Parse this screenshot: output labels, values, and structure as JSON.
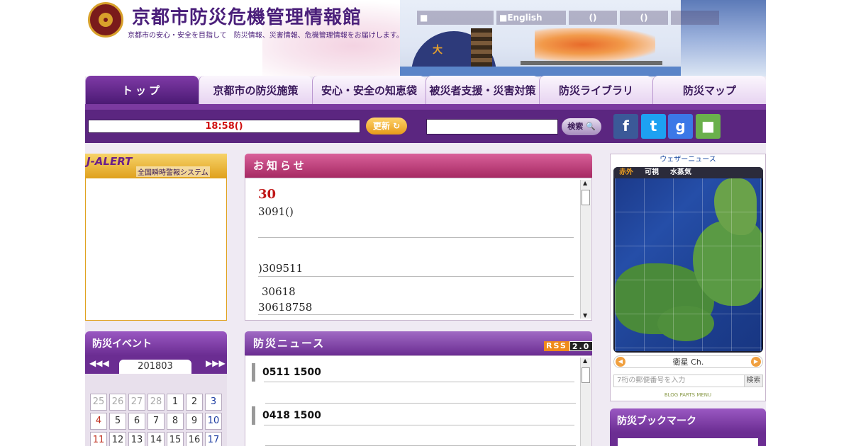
{
  "header": {
    "title": "京都市防災危機管理情報館",
    "subtitle": "京都市の安心・安全を目指して　防災情報、災害情報、危機管理情報をお届けします。",
    "scenery_char": "大",
    "topnav": [
      "■",
      "■English",
      "()",
      "()"
    ]
  },
  "mainmenu": [
    "トップ",
    "京都市の防災施策",
    "安心・安全の知恵袋",
    "被災者支援・災害対策",
    "防災ライブラリ",
    "防災マップ"
  ],
  "toolbar": {
    "clock": "18:58()",
    "refresh_label": "更新",
    "search_placeholder": "",
    "search_label": "検索",
    "social": [
      "f",
      "t",
      "g",
      "■"
    ]
  },
  "jalert": {
    "title": "J-ALERT",
    "subtitle": "全国瞬時警報システム"
  },
  "notice": {
    "title": "お知らせ",
    "items": [
      "30",
      "3091()",
      ")309511",
      "30618",
      "30618758"
    ]
  },
  "events": {
    "title": "防災イベント",
    "month": "201803",
    "prev": "◀◀◀",
    "next": "▶▶▶",
    "days": [
      "25",
      "26",
      "27",
      "28",
      "1",
      "2",
      "3",
      "4",
      "5",
      "6",
      "7",
      "8",
      "9",
      "10",
      "11",
      "12",
      "13",
      "14",
      "15",
      "16",
      "17"
    ]
  },
  "news": {
    "title": "防災ニュース",
    "rss_label": "RSS",
    "rss_version": "2.0",
    "items": [
      "0511 1500",
      "0418 1500"
    ]
  },
  "weather": {
    "title": "ウェザーニュース",
    "tabs": [
      "赤外",
      "可視",
      "水蒸気"
    ],
    "channel": "衛星 Ch.",
    "zip_placeholder": "7桁の郵便番号を入力",
    "zip_button": "検索",
    "blog_parts": "BLOG PARTS MENU"
  },
  "bookmark": {
    "title": "防災ブックマーク"
  },
  "colors": {
    "brand_purple": "#5b2680",
    "notice_pink": "#a62a63",
    "alert_red": "#d01010"
  }
}
